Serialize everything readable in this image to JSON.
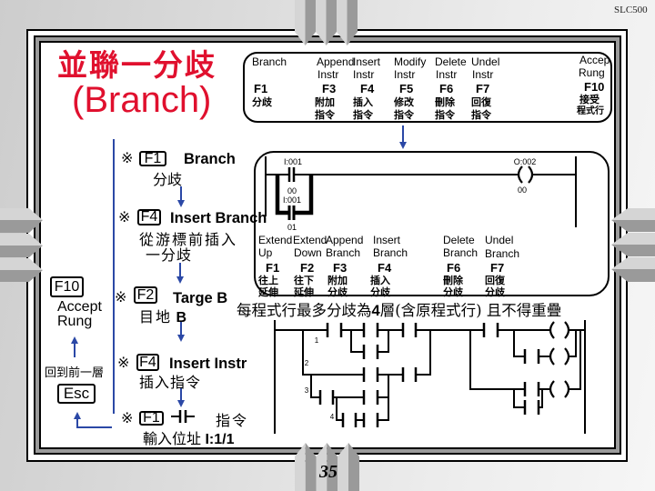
{
  "header": {
    "product_label": "SLC500",
    "page_number": "35"
  },
  "title": {
    "chinese": "並聯一分歧",
    "english": "(Branch)"
  },
  "main_menu": {
    "items": [
      {
        "label": "Branch",
        "label2": "",
        "key": "F1",
        "zh": "分歧",
        "zh2": ""
      },
      {
        "label": "Append",
        "label2": "Instr",
        "key": "F3",
        "zh": "附加",
        "zh2": "指令"
      },
      {
        "label": "Insert",
        "label2": "Instr",
        "key": "F4",
        "zh": "插入",
        "zh2": "指令"
      },
      {
        "label": "Modify",
        "label2": "Instr",
        "key": "F5",
        "zh": "修改",
        "zh2": "指令"
      },
      {
        "label": "Delete",
        "label2": "Instr",
        "key": "F6",
        "zh": "刪除",
        "zh2": "指令"
      },
      {
        "label": "Undel",
        "label2": "Instr",
        "key": "F7",
        "zh": "回復",
        "zh2": "指令"
      },
      {
        "label": "Accep",
        "label2": "Rung",
        "key": "F10",
        "zh": "接受",
        "zh2": "程式行"
      }
    ]
  },
  "branch_menu": {
    "rung": {
      "contact1_address": "I:001",
      "contact1_bit": "00",
      "contact2_address": "I:001",
      "contact2_bit": "01",
      "coil_address": "O:002",
      "coil_bit": "00"
    },
    "items": [
      {
        "label": "Extend",
        "label2": "Up",
        "key": "F1",
        "zh": "往上",
        "zh2": "延伸"
      },
      {
        "label": "Extend",
        "label2": "Down",
        "key": "F2",
        "zh": "往下",
        "zh2": "延伸"
      },
      {
        "label": "Append",
        "label2": "Branch",
        "key": "F3",
        "zh": "附加",
        "zh2": "分歧"
      },
      {
        "label": "Insert",
        "label2": "Branch",
        "key": "F4",
        "zh": "插入",
        "zh2": "分歧"
      },
      {
        "label": "Delete",
        "label2": "Branch",
        "key": "F6",
        "zh": "刪除",
        "zh2": "分歧"
      },
      {
        "label": "Undel",
        "label2": "Branch",
        "key": "F7",
        "zh": "回復",
        "zh2": "分歧"
      }
    ]
  },
  "steps": [
    {
      "marker": "※",
      "key": "F1",
      "label": "Branch",
      "desc": "分歧"
    },
    {
      "marker": "※",
      "key": "F4",
      "label": "Insert Branch",
      "desc": "從游標前插入",
      "desc2": "一分歧"
    },
    {
      "marker": "※",
      "key": "F2",
      "label": "Targe B",
      "desc": "目地",
      "desc_target": "B"
    },
    {
      "marker": "※",
      "key": "F4",
      "label": "Insert Instr",
      "desc": "插入指令"
    },
    {
      "marker": "※",
      "key": "F1",
      "icon": "contact-icon",
      "label": "指令",
      "desc": "輸入位址",
      "address": "I:1/1"
    }
  ],
  "side_panel": {
    "accept_key": "F10",
    "accept_line1": "Accept",
    "accept_line2": "Rung",
    "back_label": "回到前一層",
    "esc_key": "Esc"
  },
  "note": {
    "prefix": "每程式行最多分歧為",
    "count": "4",
    "suffix": "層(含原程式行) 且不得重疊"
  },
  "example_ladder": {
    "branch_level_labels": [
      "1",
      "2",
      "3",
      "4"
    ]
  },
  "colors": {
    "title": "#e0102e",
    "arrow": "#2b48a6",
    "pencil_light": "#d5d5d5",
    "pencil_dark": "#9a9a9a",
    "frame_band": "#9b9b9b"
  }
}
